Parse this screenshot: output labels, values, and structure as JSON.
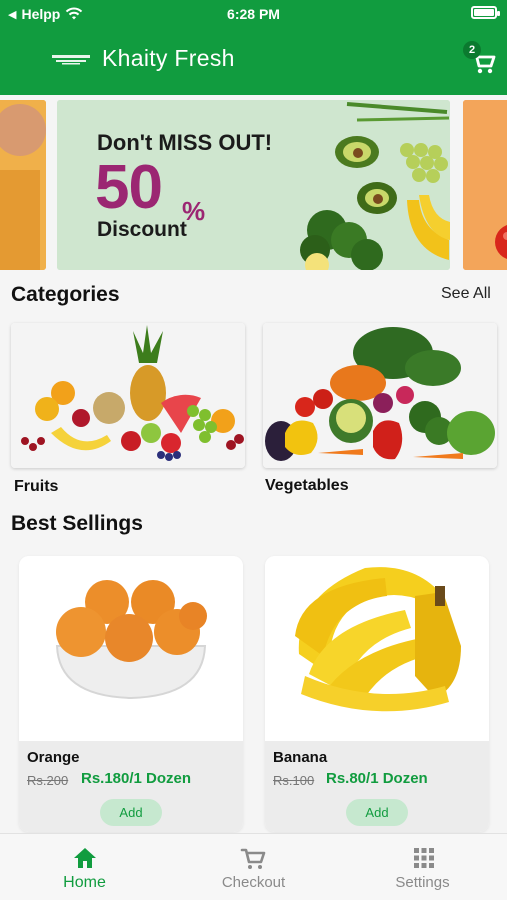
{
  "status_bar": {
    "back_app": "Helpp",
    "time": "6:28 PM"
  },
  "header": {
    "title": "Khaity Fresh",
    "cart_count": "2"
  },
  "banner": {
    "headline": "Don't MISS OUT!",
    "discount_value": "50",
    "percent_sign": "%",
    "discount_word": "Discount"
  },
  "categories": {
    "title": "Categories",
    "see_all": "See All",
    "items": [
      {
        "label": "Fruits"
      },
      {
        "label": "Vegetables"
      }
    ]
  },
  "best_sellings": {
    "title": "Best Sellings",
    "products": [
      {
        "name": "Orange",
        "old_price": "Rs.200",
        "new_price": "Rs.180/1 Dozen",
        "add_label": "Add"
      },
      {
        "name": "Banana",
        "old_price": "Rs.100",
        "new_price": "Rs.80/1 Dozen",
        "add_label": "Add"
      }
    ]
  },
  "tabbar": {
    "items": [
      {
        "label": "Home",
        "icon": "home-icon",
        "active": true
      },
      {
        "label": "Checkout",
        "icon": "cart-icon",
        "active": false
      },
      {
        "label": "Settings",
        "icon": "grid-icon",
        "active": false
      }
    ]
  },
  "colors": {
    "primary": "#119c3f",
    "discount": "#9b2672",
    "add_bg": "#c6e8cf"
  }
}
